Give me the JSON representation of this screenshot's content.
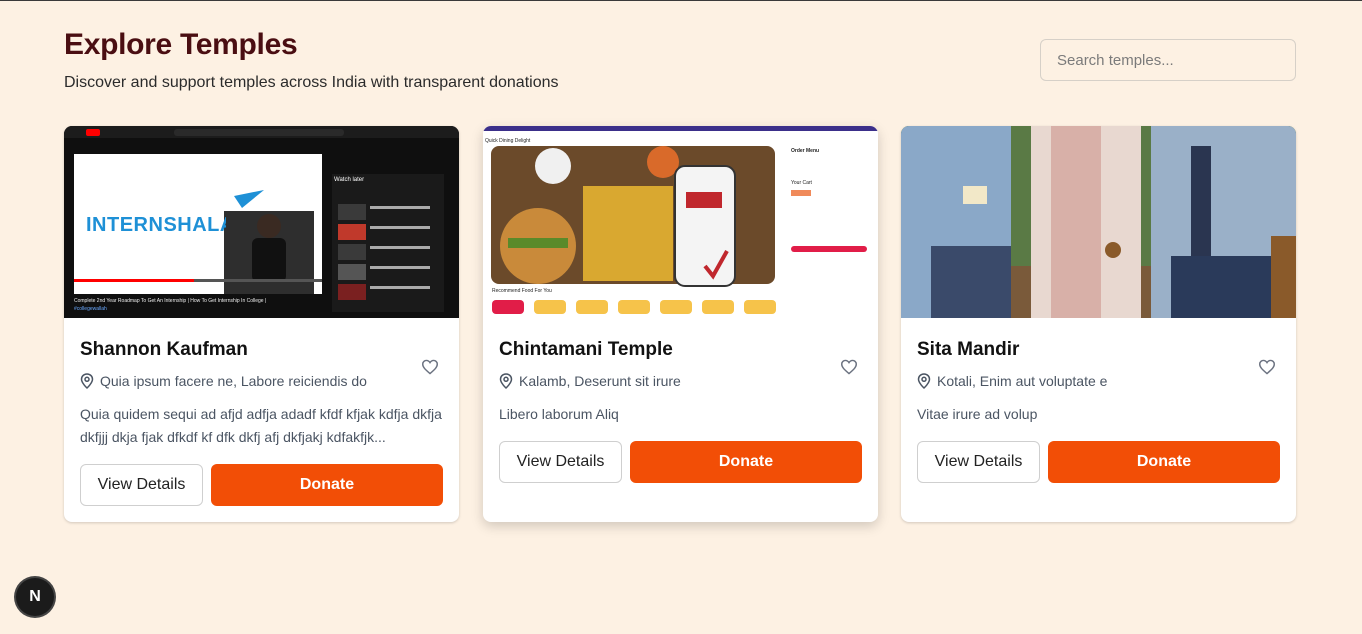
{
  "header": {
    "title": "Explore Temples",
    "subtitle": "Discover and support temples across India with transparent donations"
  },
  "search": {
    "placeholder": "Search temples..."
  },
  "cards": [
    {
      "name": "Shannon Kaufman",
      "location": "Quia ipsum facere ne, Labore reiciendis do",
      "description": "Quia quidem sequi ad afjd adfja adadf kfdf kfjak kdfja dkfja dkfjjj dkja fjak dfkdf kf dfk dkfj afj dkfjakj kdfakfjk...",
      "view_label": "View Details",
      "donate_label": "Donate",
      "thumb": {
        "brand": "INTERNSHALA",
        "video_title": "Complete 2nd Year Roadmap To Get An Internship | How To Get Internship In College |",
        "channel": "#collegewallah",
        "sidebar_title": "Watch later"
      }
    },
    {
      "name": "Chintamani Temple",
      "location": "Kalamb, Deserunt sit irure",
      "description": "Libero laborum Aliq",
      "view_label": "View Details",
      "donate_label": "Donate",
      "thumb": {
        "app_title": "Quick Dining Delight",
        "recommend": "Recommend Food For You",
        "order_title": "Order Menu",
        "cart_title": "Your Cart"
      }
    },
    {
      "name": "Sita Mandir",
      "location": "Kotali, Enim aut voluptate e",
      "description": "Vitae irure ad volup",
      "view_label": "View Details",
      "donate_label": "Donate"
    }
  ],
  "badge": {
    "letter": "N"
  },
  "colors": {
    "accent": "#f24e06",
    "title": "#4a0e12",
    "background": "#fdf1e3"
  },
  "icons": [
    "heart-icon",
    "map-pin-icon"
  ]
}
